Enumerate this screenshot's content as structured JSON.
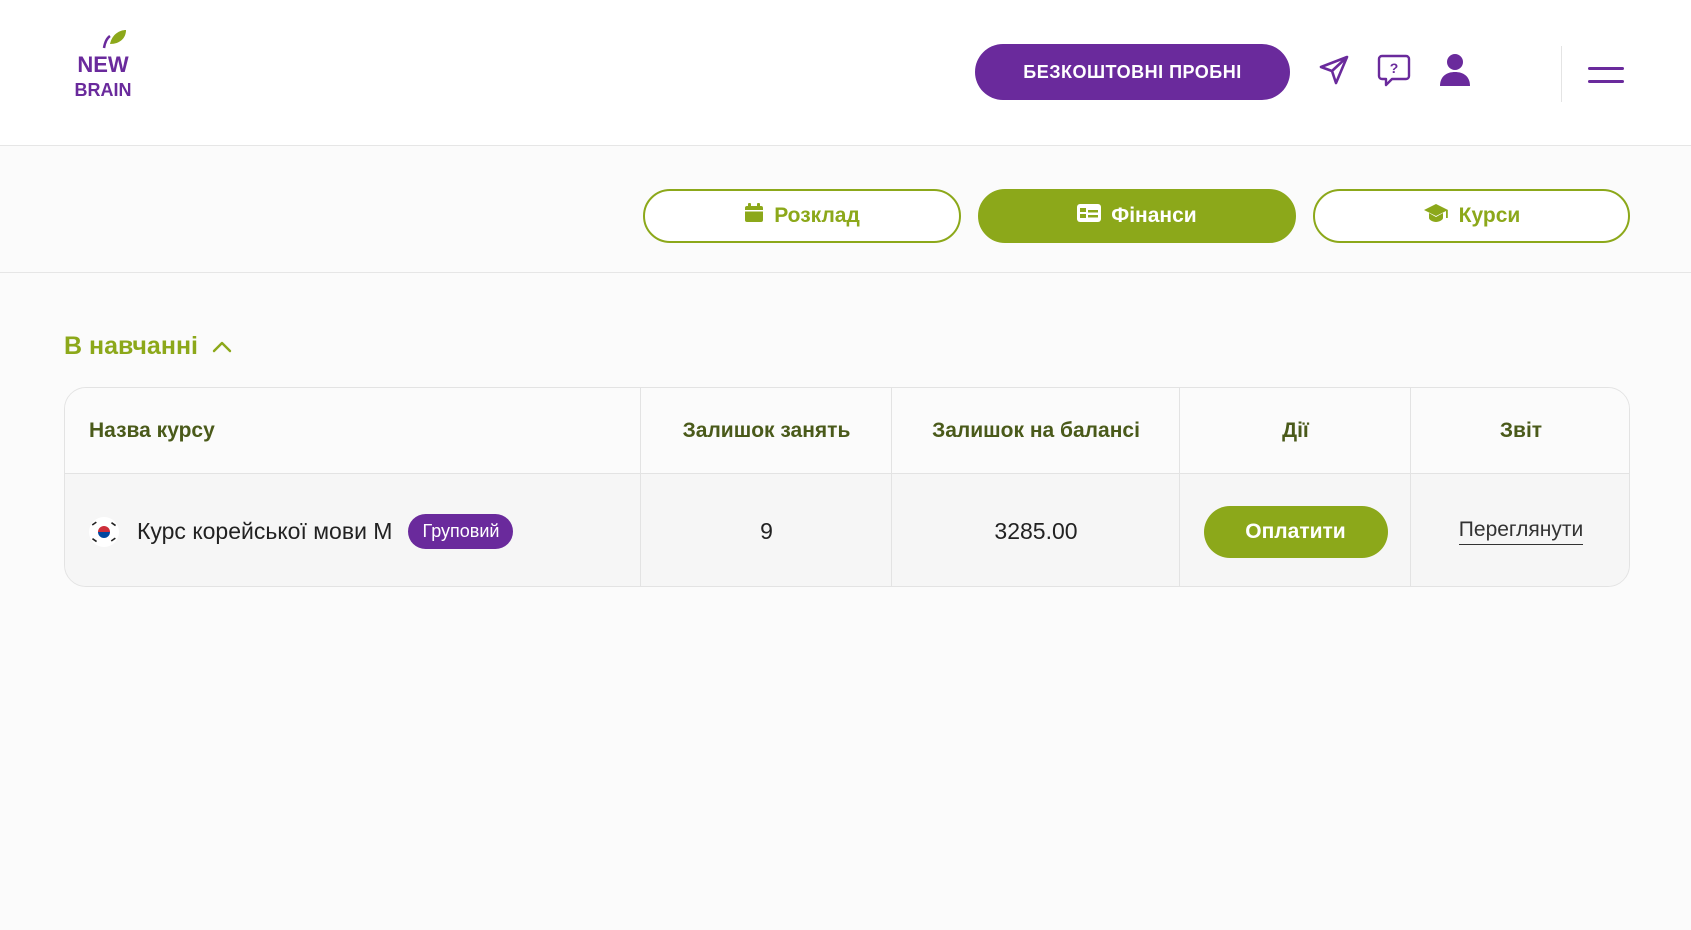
{
  "header": {
    "logo_text_top": "NEW",
    "logo_text_bottom": "BRAIN",
    "cta_label": "БЕЗКОШТОВНІ  ПРОБНІ",
    "icons": [
      "send-icon",
      "help-chat-icon",
      "user-icon",
      "menu-icon"
    ]
  },
  "nav": {
    "tabs": [
      {
        "label": "Розклад",
        "icon": "calendar-icon",
        "active": false
      },
      {
        "label": "Фінанси",
        "icon": "finance-card-icon",
        "active": true
      },
      {
        "label": "Курси",
        "icon": "graduation-cap-icon",
        "active": false
      }
    ]
  },
  "section": {
    "title": "В навчанні",
    "expanded": true
  },
  "table": {
    "headers": [
      "Назва курсу",
      "Залишок занять",
      "Залишок на балансі",
      "Дії",
      "Звіт"
    ],
    "rows": [
      {
        "course": "Курс корейської мови М",
        "flag": "south-korea-flag-icon",
        "badge": "Груповий",
        "lessons_left": "9",
        "balance": "3285.00",
        "action": "Оплатити",
        "report": "Переглянути"
      }
    ]
  },
  "colors": {
    "brand_purple": "#6a2a9c",
    "accent_green": "#8ca81a",
    "background": "#fbfbfb"
  }
}
